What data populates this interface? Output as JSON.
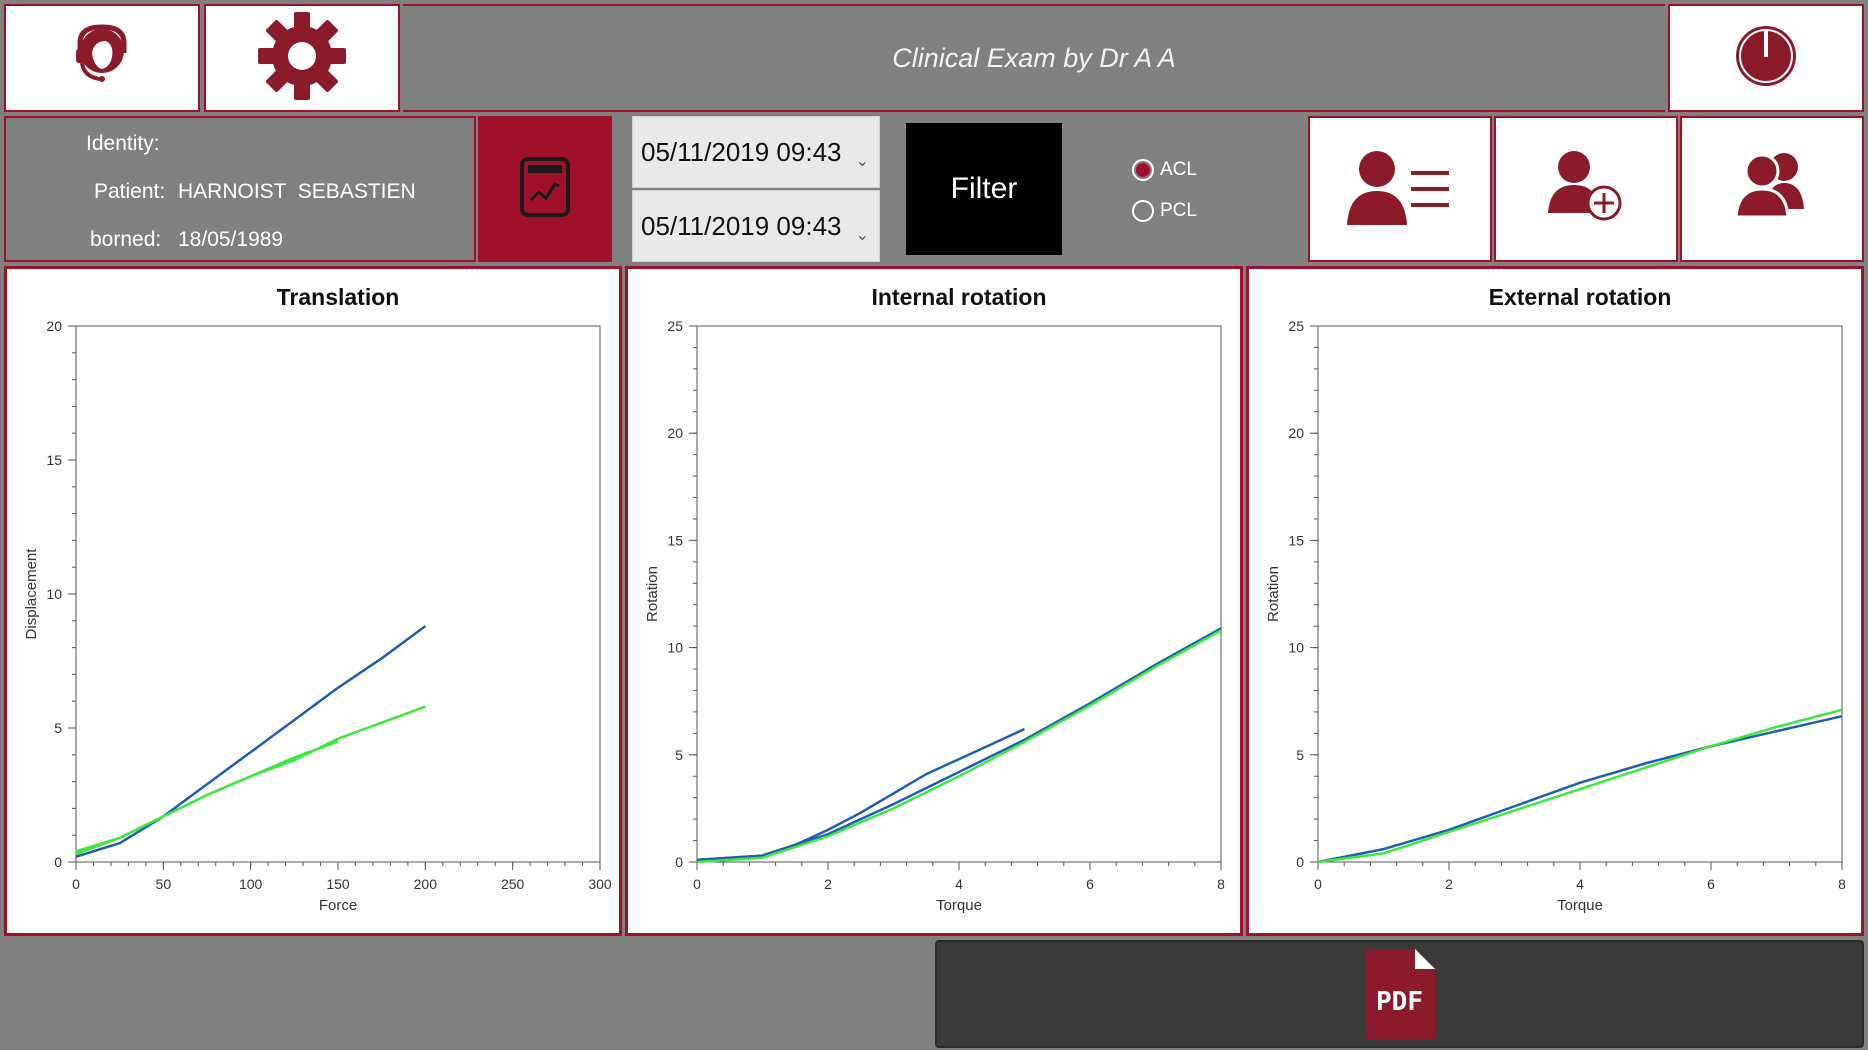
{
  "header": {
    "title": "Clinical Exam by Dr  A A"
  },
  "identity": {
    "heading": "Identity:",
    "patient_label": "Patient:",
    "patient_name": "HARNOIST  SEBASTIEN",
    "born_label": "borned:",
    "born_date": "18/05/1989"
  },
  "dates": {
    "start": "05/11/2019 09:43",
    "end": "05/11/2019 09:43"
  },
  "filter_label": "Filter",
  "radios": [
    {
      "label": "ACL",
      "checked": true
    },
    {
      "label": "PCL",
      "checked": false
    }
  ],
  "icons": {
    "support": "headset-icon",
    "settings": "gear-icon",
    "power": "power-icon",
    "report": "report-chart-icon",
    "patient_list": "patient-list-icon",
    "add_patient": "add-patient-icon",
    "patients": "patients-icon",
    "pdf": "pdf-icon"
  },
  "pdf_label": "PDF",
  "colors": {
    "accent": "#a0102a",
    "series_blue": "#1f5fb0",
    "series_green": "#3ee83e"
  },
  "chart_data": [
    {
      "type": "line",
      "title": "Translation",
      "xlabel": "Force",
      "ylabel": "Displacement",
      "xlim": [
        0,
        300
      ],
      "ylim": [
        0,
        20
      ],
      "xticks": [
        0,
        50,
        100,
        150,
        200,
        250,
        300
      ],
      "yticks": [
        0,
        5,
        10,
        15,
        20
      ],
      "series": [
        {
          "color": "#1f5fb0",
          "x": [
            0,
            25,
            50,
            75,
            100,
            125,
            150,
            175,
            200
          ],
          "y": [
            0.2,
            0.7,
            1.7,
            2.9,
            4.1,
            5.3,
            6.5,
            7.6,
            8.8
          ]
        },
        {
          "color": "#3ee83e",
          "x": [
            0,
            25,
            50,
            75,
            100,
            125,
            150
          ],
          "y": [
            0.3,
            0.9,
            1.7,
            2.5,
            3.2,
            3.9,
            4.5
          ]
        },
        {
          "color": "#3ee83e",
          "x": [
            0,
            25,
            50,
            75,
            100,
            125,
            150,
            175,
            200
          ],
          "y": [
            0.4,
            0.9,
            1.7,
            2.5,
            3.2,
            3.8,
            4.6,
            5.2,
            5.8
          ]
        }
      ]
    },
    {
      "type": "line",
      "title": "Internal rotation",
      "xlabel": "Torque",
      "ylabel": "Rotation",
      "xlim": [
        0,
        8
      ],
      "ylim": [
        0,
        25
      ],
      "xticks": [
        0,
        2,
        4,
        6,
        8
      ],
      "yticks": [
        0,
        5,
        10,
        15,
        20,
        25
      ],
      "series": [
        {
          "color": "#1f5fb0",
          "x": [
            0,
            1,
            1.5,
            2,
            2.5,
            3,
            3.5,
            4,
            4.5,
            5
          ],
          "y": [
            0.1,
            0.3,
            0.8,
            1.5,
            2.3,
            3.2,
            4.1,
            4.8,
            5.5,
            6.2
          ]
        },
        {
          "color": "#1f5fb0",
          "x": [
            0,
            1,
            2,
            3,
            4,
            5,
            6,
            7,
            8
          ],
          "y": [
            0.1,
            0.3,
            1.3,
            2.7,
            4.2,
            5.7,
            7.4,
            9.2,
            10.9
          ]
        },
        {
          "color": "#3ee83e",
          "x": [
            0,
            1,
            2,
            3,
            4,
            5,
            6,
            7,
            8
          ],
          "y": [
            0.0,
            0.2,
            1.2,
            2.5,
            4.0,
            5.6,
            7.3,
            9.1,
            10.8
          ]
        }
      ]
    },
    {
      "type": "line",
      "title": "External rotation",
      "xlabel": "Torque",
      "ylabel": "Rotation",
      "xlim": [
        0,
        8
      ],
      "ylim": [
        0,
        25
      ],
      "xticks": [
        0,
        2,
        4,
        6,
        8
      ],
      "yticks": [
        0,
        5,
        10,
        15,
        20,
        25
      ],
      "series": [
        {
          "color": "#1f5fb0",
          "x": [
            0,
            1,
            2,
            3,
            4,
            5,
            6,
            7,
            8
          ],
          "y": [
            0.0,
            0.6,
            1.5,
            2.6,
            3.7,
            4.6,
            5.4,
            6.1,
            6.8
          ]
        },
        {
          "color": "#3ee83e",
          "x": [
            0,
            1,
            2,
            3,
            4,
            5,
            6,
            7,
            8
          ],
          "y": [
            0.0,
            0.4,
            1.4,
            2.4,
            3.4,
            4.4,
            5.4,
            6.3,
            7.1
          ]
        }
      ]
    }
  ]
}
